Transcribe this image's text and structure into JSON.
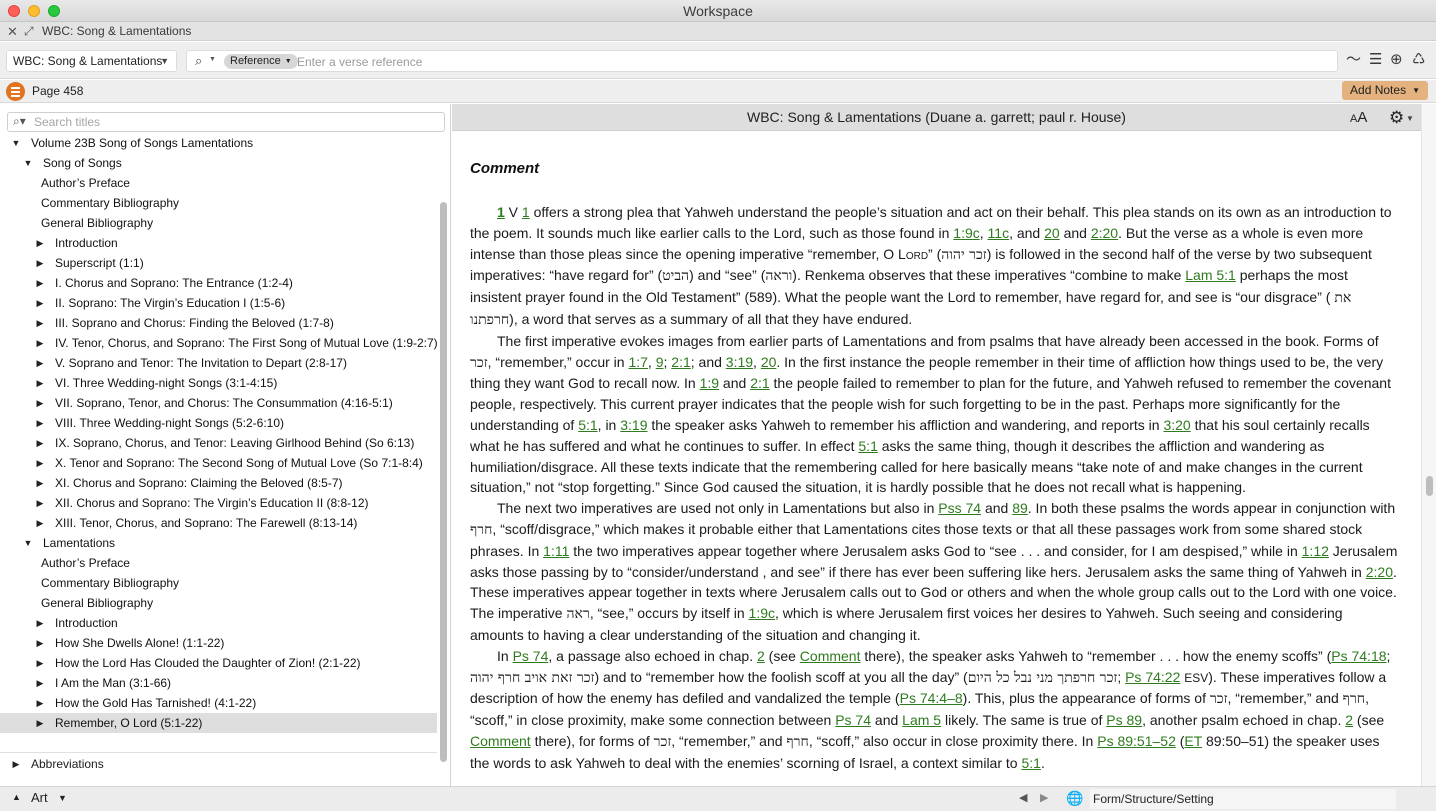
{
  "window": {
    "title": "Workspace"
  },
  "tab": {
    "title": "WBC: Song & Lamentations"
  },
  "toolbar": {
    "resource_label": "WBC: Song & Lamentations",
    "reference_chip": "Reference",
    "reference_placeholder": "Enter a verse reference",
    "icons": [
      "search-icon",
      "timeline-icon",
      "text-align-icon",
      "add-circle-icon",
      "recycle-icon"
    ]
  },
  "pagebar": {
    "page_label": "Page 458",
    "add_notes": "Add Notes"
  },
  "sidebar": {
    "search_placeholder": "Search titles",
    "tree": [
      {
        "label": "Volume 23B Song of Songs Lamentations",
        "level": 0,
        "toggle": "open"
      },
      {
        "label": "Song of Songs",
        "level": 1,
        "toggle": "open"
      },
      {
        "label": "Author’s Preface",
        "level": 2,
        "toggle": "none"
      },
      {
        "label": "Commentary Bibliography",
        "level": 2,
        "toggle": "none"
      },
      {
        "label": "General Bibliography",
        "level": 2,
        "toggle": "none"
      },
      {
        "label": "Introduction",
        "level": 2,
        "toggle": "closed"
      },
      {
        "label": "Superscript (1:1)",
        "level": 2,
        "toggle": "closed"
      },
      {
        "label": "I. Chorus and Soprano: The Entrance (1:2-4)",
        "level": 2,
        "toggle": "closed"
      },
      {
        "label": "II. Soprano: The Virgin’s Education I (1:5-6)",
        "level": 2,
        "toggle": "closed"
      },
      {
        "label": "III. Soprano and Chorus: Finding the Beloved (1:7-8)",
        "level": 2,
        "toggle": "closed"
      },
      {
        "label": "IV. Tenor, Chorus, and Soprano: The First Song of Mutual Love (1:9-2:7)",
        "level": 2,
        "toggle": "closed"
      },
      {
        "label": "V. Soprano and Tenor: The Invitation to Depart (2:8-17)",
        "level": 2,
        "toggle": "closed"
      },
      {
        "label": "VI. Three Wedding-night Songs (3:1-4:15)",
        "level": 2,
        "toggle": "closed"
      },
      {
        "label": "VII. Soprano, Tenor, and Chorus: The Consummation (4:16-5:1)",
        "level": 2,
        "toggle": "closed"
      },
      {
        "label": "VIII. Three Wedding-night Songs (5:2-6:10)",
        "level": 2,
        "toggle": "closed"
      },
      {
        "label": "IX. Soprano, Chorus, and Tenor: Leaving Girlhood Behind (So 6:13)",
        "level": 2,
        "toggle": "closed"
      },
      {
        "label": "X. Tenor and Soprano: The Second Song of Mutual Love (So 7:1-8:4)",
        "level": 2,
        "toggle": "closed"
      },
      {
        "label": "XI. Chorus and Soprano: Claiming the Beloved (8:5-7)",
        "level": 2,
        "toggle": "closed"
      },
      {
        "label": "XII. Chorus and Soprano: The Virgin’s Education II (8:8-12)",
        "level": 2,
        "toggle": "closed"
      },
      {
        "label": "XIII. Tenor, Chorus, and Soprano: The Farewell (8:13-14)",
        "level": 2,
        "toggle": "closed"
      },
      {
        "label": "Lamentations",
        "level": 1,
        "toggle": "open"
      },
      {
        "label": "Author’s Preface",
        "level": 2,
        "toggle": "none"
      },
      {
        "label": "Commentary Bibliography",
        "level": 2,
        "toggle": "none"
      },
      {
        "label": "General Bibliography",
        "level": 2,
        "toggle": "none"
      },
      {
        "label": "Introduction",
        "level": 2,
        "toggle": "closed"
      },
      {
        "label": "How She Dwells Alone!  (1:1-22)",
        "level": 2,
        "toggle": "closed"
      },
      {
        "label": "How the Lord Has Clouded the Daughter of Zion!  (2:1-22)",
        "level": 2,
        "toggle": "closed"
      },
      {
        "label": "I Am the Man (3:1-66)",
        "level": 2,
        "toggle": "closed"
      },
      {
        "label": "How the Gold Has Tarnished!  (4:1-22)",
        "level": 2,
        "toggle": "closed"
      },
      {
        "label": "Remember, O Lord (5:1-22)",
        "level": 2,
        "toggle": "closed",
        "selected": true
      }
    ],
    "abbreviations": "Abbreviations"
  },
  "document": {
    "header_title": "WBC: Song & Lamentations (Duane a. garrett; paul r. House)",
    "aa_label": "A",
    "heading": "Comment"
  },
  "statusbar": {
    "left_label": "Art",
    "section": "Form/Structure/Setting"
  },
  "colors": {
    "link": "#2f7a1f",
    "accent_orange": "#e2731f",
    "add_notes_bg": "#e3b27e",
    "selection_bg": "#dedede"
  }
}
